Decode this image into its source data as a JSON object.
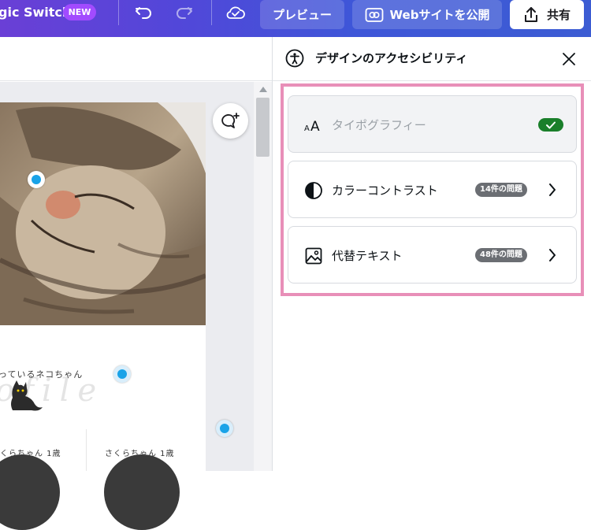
{
  "topbar": {
    "brand": "gic Switch",
    "new_badge": "NEW",
    "preview_label": "プレビュー",
    "publish_label": "Webサイトを公開",
    "share_label": "共有"
  },
  "canvas": {
    "profile_text": "っているネコちゃん",
    "script_text": "ofile",
    "name_left": "くらちゃん 1歳",
    "name_right": "さくらちゃん 1歳"
  },
  "panel": {
    "title": "デザインのアクセシビリティ",
    "items": [
      {
        "label": "タイポグラフィー",
        "icon": "typography-icon",
        "status": "passed"
      },
      {
        "label": "カラーコントラスト",
        "icon": "contrast-icon",
        "badge": "14件の問題"
      },
      {
        "label": "代替テキスト",
        "icon": "image-icon",
        "badge": "48件の問題"
      }
    ]
  },
  "colors": {
    "highlight": "#e88fb8",
    "check": "#1a7f2a",
    "badge": "#6b6e73",
    "dot": "#1aa3e8"
  }
}
